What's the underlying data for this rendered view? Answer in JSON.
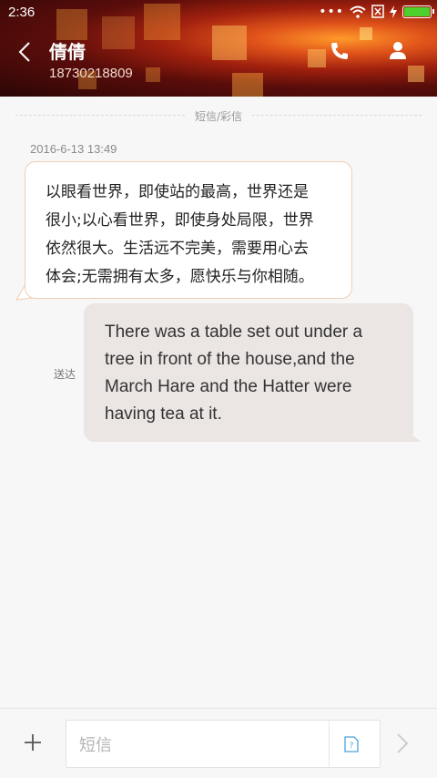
{
  "status_bar": {
    "time": "2:36",
    "icons": [
      "more-dots-icon",
      "wifi-icon",
      "no-sim-icon",
      "charging-icon",
      "battery-icon"
    ]
  },
  "header": {
    "contact_name": "倩倩",
    "contact_number": "18730218809",
    "icons": [
      "back-arrow-icon",
      "phone-icon",
      "contact-person-icon"
    ]
  },
  "thread": {
    "type_divider": "短信/彩信",
    "timestamp": "2016-6-13 13:49",
    "messages": [
      {
        "direction": "incoming",
        "lines": [
          "以眼看世界，即使站的最高，世界还是",
          "很小;以心看世界，即使身处局限，世界",
          "依然很大。生活远不完美，需要用心去",
          "体会;无需拥有太多，愿快乐与你相随。"
        ]
      },
      {
        "direction": "outgoing",
        "status": "送达",
        "lines": [
          "There was a table set out under a",
          "tree in front of the house,and the",
          "March Hare and the Hatter were",
          "having tea at it."
        ]
      }
    ]
  },
  "composer": {
    "placeholder": "短信",
    "value": "",
    "icons": [
      "plus-icon",
      "sms-type-icon",
      "send-arrow-icon"
    ]
  },
  "colors": {
    "incoming_border": "#f0cdb2",
    "outgoing_bg": "#ebe5e3",
    "battery": "#4ed12c"
  }
}
